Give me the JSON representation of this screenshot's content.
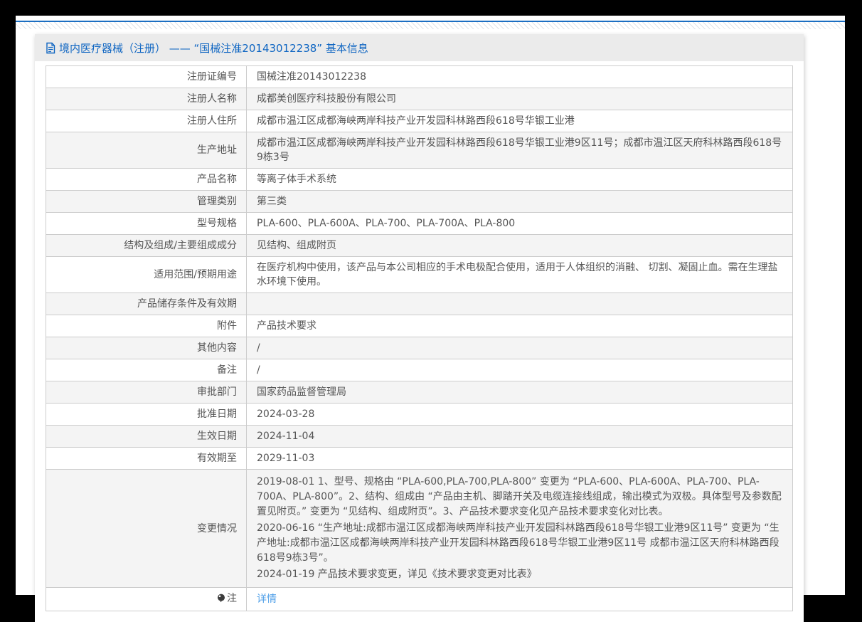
{
  "header": {
    "title": "境内医疗器械（注册） —— “国械注准20143012238” 基本信息",
    "icon": "document-icon"
  },
  "colors": {
    "accent_line": "#1b6ec2",
    "title_text": "#0e65c2",
    "link": "#4f9fe8",
    "row_stripe": "#f4f4f4",
    "border": "#cccccc",
    "text": "#555555"
  },
  "table": {
    "rows": [
      {
        "type": "text",
        "label": "注册证编号",
        "value": "国械注准20143012238"
      },
      {
        "type": "text",
        "label": "注册人名称",
        "value": "成都美创医疗科技股份有限公司"
      },
      {
        "type": "text",
        "label": "注册人住所",
        "value": "成都市温江区成都海峡两岸科技产业开发园科林路西段618号华银工业港"
      },
      {
        "type": "text",
        "label": "生产地址",
        "value": "成都市温江区成都海峡两岸科技产业开发园科林路西段618号华银工业港9区11号；成都市温江区天府科林路西段618号9栋3号"
      },
      {
        "type": "text",
        "label": "产品名称",
        "value": "等离子体手术系统"
      },
      {
        "type": "text",
        "label": "管理类别",
        "value": "第三类"
      },
      {
        "type": "text",
        "label": "型号规格",
        "value": "PLA-600、PLA-600A、PLA-700、PLA-700A、PLA-800"
      },
      {
        "type": "text",
        "label": "结构及组成/主要组成成分",
        "value": "见结构、组成附页"
      },
      {
        "type": "text",
        "label": "适用范围/预期用途",
        "value": "在医疗机构中使用，该产品与本公司相应的手术电极配合使用，适用于人体组织的消融、 切割、凝固止血。需在生理盐水环境下使用。"
      },
      {
        "type": "empty",
        "label": "产品储存条件及有效期",
        "value": ""
      },
      {
        "type": "text",
        "label": "附件",
        "value": "产品技术要求"
      },
      {
        "type": "text",
        "label": "其他内容",
        "value": "/"
      },
      {
        "type": "text",
        "label": "备注",
        "value": "/"
      },
      {
        "type": "text",
        "label": "审批部门",
        "value": "国家药品监督管理局"
      },
      {
        "type": "text",
        "label": "批准日期",
        "value": "2024-03-28"
      },
      {
        "type": "text",
        "label": "生效日期",
        "value": "2024-11-04"
      },
      {
        "type": "text",
        "label": "有效期至",
        "value": "2029-11-03"
      },
      {
        "type": "multiline",
        "label": "变更情况",
        "lines": [
          "2019-08-01 1、型号、规格由 “PLA-600,PLA-700,PLA-800” 变更为 “PLA-600、PLA-600A、PLA-700、PLA-700A、PLA-800”。2、结构、组成由 “产品由主机、脚踏开关及电缆连接线组成，输出模式为双极。具体型号及参数配置见附页。” 变更为 “见结构、组成附页”。3、产品技术要求变化见产品技术要求变化对比表。",
          "2020-06-16 “生产地址:成都市温江区成都海峡两岸科技产业开发园科林路西段618号华银工业港9区11号” 变更为 “生产地址:成都市温江区成都海峡两岸科技产业开发园科林路西段618号华银工业港9区11号 成都市温江区天府科林路西段618号9栋3号”。",
          "2024-01-19 产品技术要求变更，详见《技术要求变更对比表》"
        ]
      },
      {
        "type": "link",
        "label": "注",
        "label_icon": "bulb-icon",
        "value": "详情"
      }
    ]
  }
}
